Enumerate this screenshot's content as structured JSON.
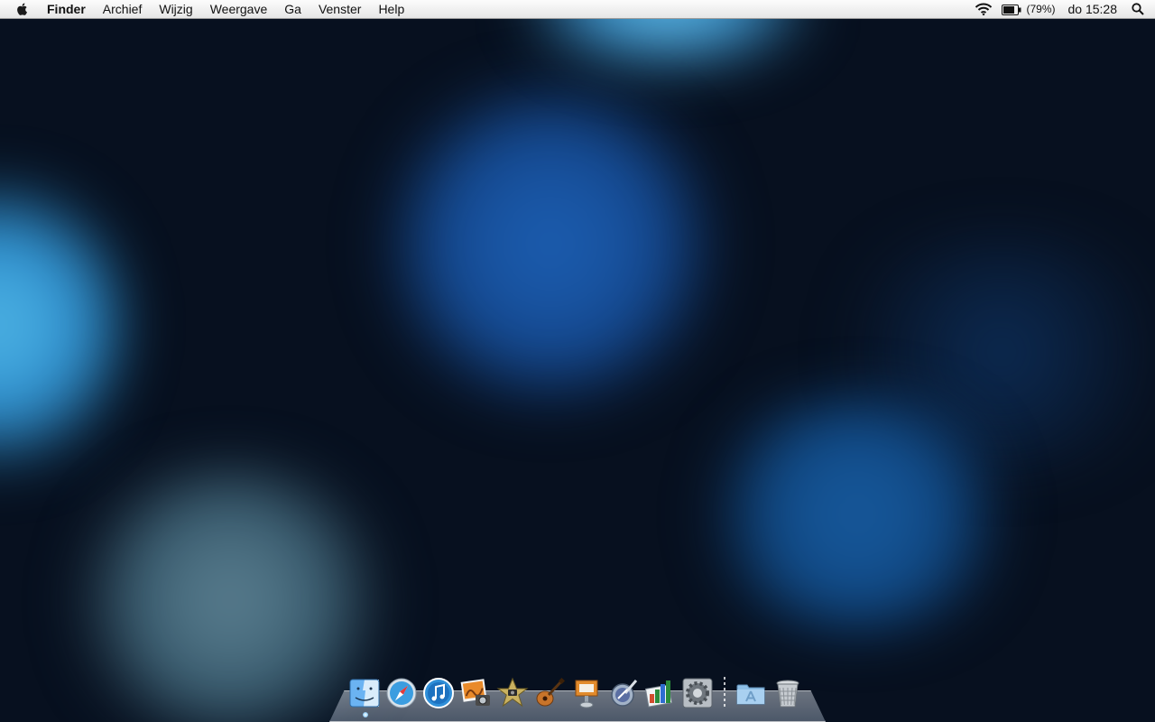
{
  "menubar": {
    "apple_icon": "apple-logo-icon",
    "app_name": "Finder",
    "items": [
      "Archief",
      "Wijzig",
      "Weergave",
      "Ga",
      "Venster",
      "Help"
    ],
    "status": {
      "wifi_icon": "wifi-icon",
      "battery_icon": "battery-icon",
      "battery_percent": "(79%)",
      "clock": "do 15:28",
      "spotlight_icon": "spotlight-search-icon"
    }
  },
  "desktop": {
    "wallpaper": "blue bokeh",
    "colors": {
      "base": "#07101f",
      "bokeh_blue": "#1c5fb3",
      "bokeh_cyan": "#52b8e6",
      "bokeh_grey": "#5d8192"
    }
  },
  "dock": {
    "apps": [
      "finder",
      "safari",
      "itunes",
      "iphoto",
      "imovie",
      "garageband",
      "keynote",
      "preview",
      "numbers",
      "system-preferences"
    ],
    "right_items": [
      "applications-folder",
      "trash"
    ],
    "running_indicator": "finder"
  }
}
